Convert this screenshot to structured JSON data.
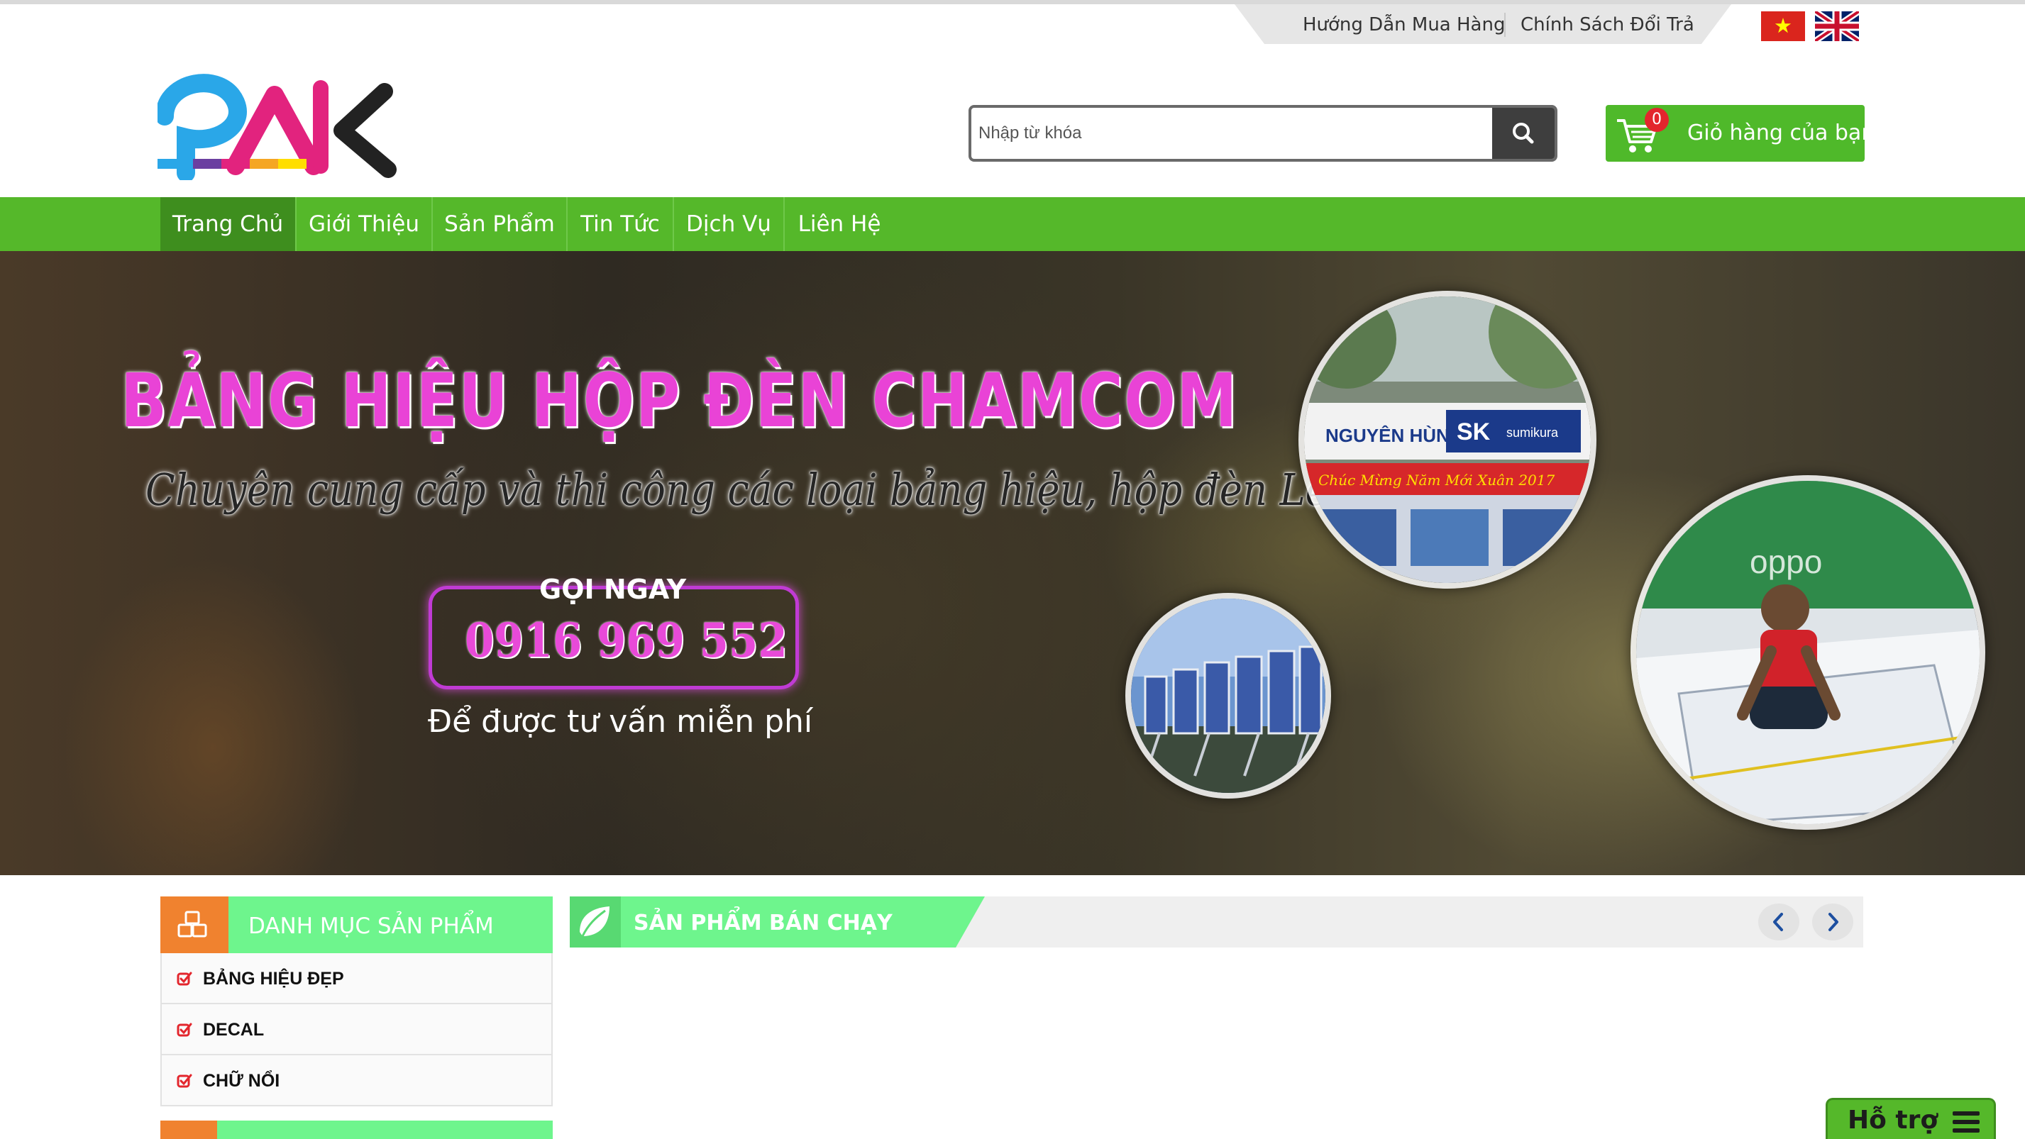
{
  "top_links": [
    "Hướng Dẫn Mua Hàng",
    "Chính Sách Đổi Trả"
  ],
  "languages": [
    {
      "name": "vietnam-flag-icon",
      "colors": [
        "#da251d",
        "#ffff00"
      ]
    },
    {
      "name": "uk-flag-icon",
      "colors": [
        "#012169",
        "#c8102e",
        "#ffffff"
      ]
    }
  ],
  "logo": {
    "text": "PAK"
  },
  "search": {
    "placeholder": "Nhập từ khóa",
    "icon": "search-icon"
  },
  "cart": {
    "label": "Giỏ hàng của bạn",
    "count": "0",
    "icon": "cart-icon"
  },
  "nav": {
    "items": [
      {
        "label": "Trang Chủ",
        "active": true
      },
      {
        "label": "Giới Thiệu",
        "active": false
      },
      {
        "label": "Sản Phẩm",
        "active": false
      },
      {
        "label": "Tin Tức",
        "active": false
      },
      {
        "label": "Dịch Vụ",
        "active": false
      },
      {
        "label": "Liên Hệ",
        "active": false
      }
    ]
  },
  "banner": {
    "title": "BẢNG HIỆU HỘP ĐÈN CHAMCOM",
    "subtitle": "Chuyên cung cấp và thi công các loại bảng hiệu, hộp đèn Led",
    "call_label": "GỌI NGAY",
    "phone": "0916 969 552",
    "note": "Để được tư vấn miễn phí",
    "photo_sign_texts": [
      "NGUYÊN HÙNG",
      "SK",
      "sumikura",
      "Chúc Mừng Năm Mới Xuân 2017",
      "oppo"
    ]
  },
  "sidebar": {
    "title": "DANH MỤC SẢN PHẨM",
    "items": [
      "BẢNG HIỆU ĐẸP",
      "DECAL",
      "CHỮ NỔI"
    ]
  },
  "best_sellers": {
    "title": "SẢN PHẨM BÁN CHẠY"
  },
  "support": {
    "label": "Hỗ trợ"
  },
  "colors": {
    "green": "#55b82a",
    "light_green": "#6ef58d",
    "orange": "#f0822f",
    "magenta": "#e943d6",
    "red": "#e3262d"
  }
}
